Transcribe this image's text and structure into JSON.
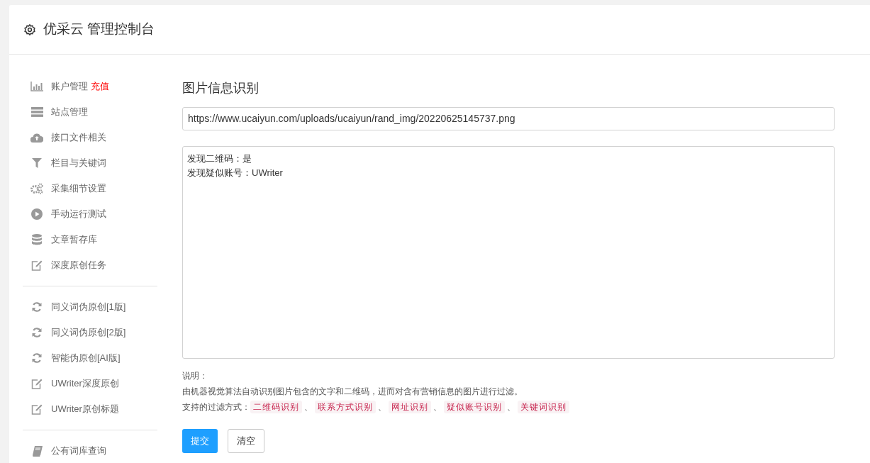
{
  "header": {
    "title": "优采云 管理控制台"
  },
  "sidebar": {
    "groups": [
      {
        "items": [
          {
            "label": "账户管理",
            "badge": "充值"
          },
          {
            "label": "站点管理"
          },
          {
            "label": "接口文件相关"
          },
          {
            "label": "栏目与关键词"
          },
          {
            "label": "采集细节设置"
          },
          {
            "label": "手动运行测试"
          },
          {
            "label": "文章暂存库"
          },
          {
            "label": "深度原创任务"
          }
        ]
      },
      {
        "items": [
          {
            "label": "同义词伪原创[1版]"
          },
          {
            "label": "同义词伪原创[2版]"
          },
          {
            "label": "智能伪原创[AI版]"
          },
          {
            "label": "UWriter深度原创"
          },
          {
            "label": "UWriter原创标题"
          }
        ]
      },
      {
        "items": [
          {
            "label": "公有词库查询"
          }
        ]
      }
    ]
  },
  "main": {
    "title": "图片信息识别",
    "url_field": {
      "value": "https://www.ucaiyun.com/uploads/ucaiyun/rand_img/20220625145737.png"
    },
    "result_field": {
      "lines": [
        "发现二维码：是",
        "发现疑似账号：UWriter"
      ]
    },
    "notes_heading": "说明：",
    "notes_text": "由机器视觉算法自动识别图片包含的文字和二维码，进而对含有营销信息的图片进行过滤。",
    "filters_label": "支持的过滤方式：",
    "filters": [
      {
        "label": "二维码识别",
        "separator": "、"
      },
      {
        "label": "联系方式识别",
        "separator": "、"
      },
      {
        "label": "网址识别",
        "separator": "、"
      },
      {
        "label": "疑似账号识别",
        "separator": "、"
      },
      {
        "label": "关键词识别"
      }
    ],
    "buttons": [
      {
        "label": "提交",
        "kind": "primary"
      },
      {
        "label": "清空",
        "kind": "default"
      }
    ]
  }
}
